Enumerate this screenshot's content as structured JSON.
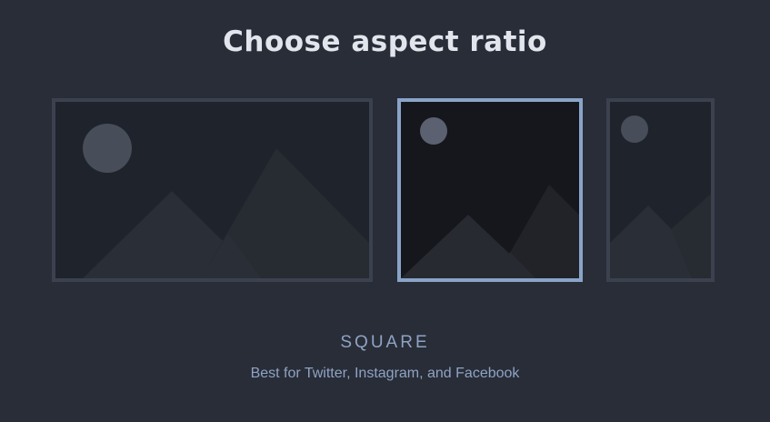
{
  "heading": "Choose aspect ratio",
  "options": [
    {
      "id": "landscape",
      "selected": false
    },
    {
      "id": "square",
      "selected": true
    },
    {
      "id": "portrait",
      "selected": false
    }
  ],
  "selection": {
    "label": "SQUARE",
    "description": "Best for Twitter, Instagram, and Facebook"
  },
  "colors": {
    "background": "#282d38",
    "card_border": "#3b414e",
    "selected_border": "#8aa4c8",
    "accent_text": "#8fa3c3",
    "heading_text": "#e2e5ec"
  },
  "icons": {
    "placeholder": "image-placeholder-icon"
  }
}
